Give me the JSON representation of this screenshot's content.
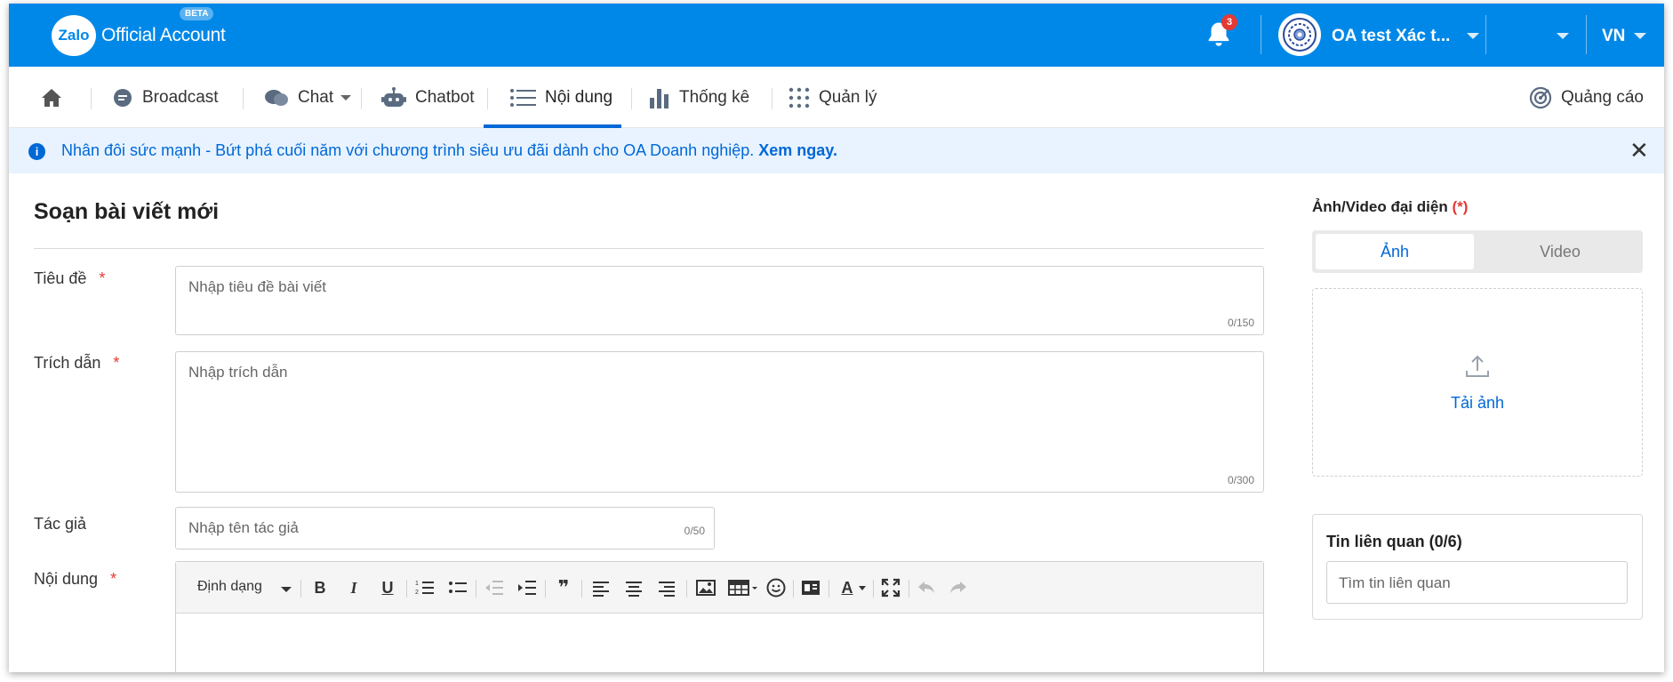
{
  "header": {
    "brand_mark": "Zalo",
    "brand_text": "Official Account",
    "beta_badge": "BETA",
    "notification_count": "3",
    "account_name": "OA test Xác t...",
    "language": "VN",
    "colors": {
      "bar": "#0088e8",
      "badge": "#e53935"
    }
  },
  "nav": {
    "home_icon": "home-icon",
    "items": [
      {
        "label": "Broadcast",
        "icon": "broadcast-icon"
      },
      {
        "label": "Chat",
        "icon": "chat-icon"
      },
      {
        "label": "Chatbot",
        "icon": "chatbot-icon"
      },
      {
        "label": "Nội dung",
        "icon": "list-icon",
        "active": true
      },
      {
        "label": "Thống kê",
        "icon": "bar-chart-icon"
      },
      {
        "label": "Quản lý",
        "icon": "grid-icon"
      }
    ],
    "ads_label": "Quảng cáo",
    "accent": "#0068d6"
  },
  "banner": {
    "text": "Nhân đôi sức mạnh - Bứt phá cuối năm với chương trình siêu ưu đãi dành cho OA Doanh nghiệp.",
    "link_text": "Xem ngay.",
    "info_glyph": "i",
    "close_glyph": "✕"
  },
  "form": {
    "title": "Soạn bài viết mới",
    "title_field": {
      "label": "Tiêu đề",
      "required": "*",
      "placeholder": "Nhập tiêu đề bài viết",
      "counter": "0/150"
    },
    "excerpt_field": {
      "label": "Trích dẫn",
      "required": "*",
      "placeholder": "Nhập trích dẫn",
      "counter": "0/300"
    },
    "author_field": {
      "label": "Tác giả",
      "placeholder": "Nhập tên tác giả",
      "counter": "0/50"
    },
    "content_field": {
      "label": "Nội dung",
      "required": "*"
    },
    "toolbar": {
      "format_label": "Định dạng",
      "bold": "B",
      "italic": "I",
      "underline": "U",
      "quote": "❞",
      "text_color": "A"
    }
  },
  "media_panel": {
    "title": "Ảnh/Video đại diện",
    "required": "(*)",
    "tab_image": "Ảnh",
    "tab_video": "Video",
    "upload_label": "Tải ảnh"
  },
  "related": {
    "title": "Tin liên quan (0/6)",
    "placeholder": "Tìm tin liên quan"
  }
}
